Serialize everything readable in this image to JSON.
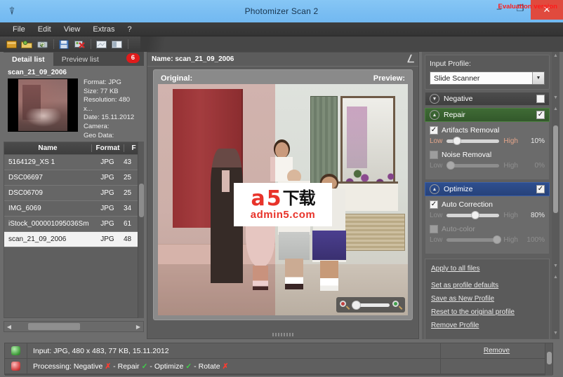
{
  "window": {
    "title": "Photomizer Scan 2",
    "app_icon": "app-logo-icon",
    "minimize": "–",
    "maximize": "❐",
    "close": "✕"
  },
  "menubar": {
    "items": [
      {
        "label": "File"
      },
      {
        "label": "Edit"
      },
      {
        "label": "View"
      },
      {
        "label": "Extras"
      },
      {
        "label": "?"
      }
    ]
  },
  "toolbar": {
    "evaluation_notice": "Evaluation version",
    "buttons": [
      {
        "name": "open-image-icon"
      },
      {
        "name": "open-folder-icon"
      },
      {
        "name": "scan-icon"
      },
      {
        "name": "save-icon"
      },
      {
        "name": "delete-icon"
      },
      {
        "name": "single-view-icon"
      },
      {
        "name": "split-view-icon"
      }
    ]
  },
  "left_panel": {
    "tabs": [
      {
        "label": "Detail list",
        "active": true
      },
      {
        "label": "Preview list",
        "active": false
      }
    ],
    "badge_count": "6",
    "detail": {
      "name": "scan_21_09_2006",
      "format": "Format: JPG",
      "size": "Size: 77 KB",
      "resolution": "Resolution: 480 x...",
      "date": "Date: 15.11.2012",
      "camera": "Camera:",
      "geo": "Geo Data:"
    },
    "table": {
      "columns": [
        "Name",
        "Format",
        "F"
      ],
      "rows": [
        {
          "name": "5164129_XS 1",
          "format": "JPG",
          "size": "43"
        },
        {
          "name": "DSC06697",
          "format": "JPG",
          "size": "25"
        },
        {
          "name": "DSC06709",
          "format": "JPG",
          "size": "25"
        },
        {
          "name": "IMG_6069",
          "format": "JPG",
          "size": "34"
        },
        {
          "name": "iStock_000001095036Sm",
          "format": "JPG",
          "size": "61"
        },
        {
          "name": "scan_21_09_2006",
          "format": "JPG",
          "size": "48",
          "selected": true
        }
      ]
    },
    "hscroll_left": "◀",
    "hscroll_right": "▶"
  },
  "center_panel": {
    "name_label": "Name: scan_21_09_2006",
    "expand_icon": "expand-icon",
    "original_label": "Original:",
    "preview_label": "Preview:",
    "watermark": {
      "letter": "a",
      "digit": "5",
      "cn": "下载",
      "site": "admin5.com"
    },
    "zoom": {
      "zoom_out_icon": "zoom-out-icon",
      "zoom_in_icon": "zoom-in-icon"
    }
  },
  "right_panel": {
    "input_profile_label": "Input Profile:",
    "input_profile_value": "Slide Scanner",
    "dropdown_arrow": "▼",
    "sections": [
      {
        "title": "Negative",
        "state": "collapsed",
        "chevron": "▼",
        "checked": false
      },
      {
        "title": "Repair",
        "state": "expanded",
        "chevron": "▲",
        "checked": true,
        "color": "#3f6b35",
        "options": [
          {
            "label": "Artifacts Removal",
            "checked": true,
            "enabled": true,
            "low": "Low",
            "high": "High",
            "value": "10",
            "unit": "%",
            "pos": 12
          },
          {
            "label": "Noise Removal",
            "checked": false,
            "enabled": false,
            "low": "Low",
            "high": "High",
            "value": "0",
            "unit": "%",
            "pos": 0
          }
        ]
      },
      {
        "title": "Optimize",
        "state": "expanded",
        "chevron": "▲",
        "checked": true,
        "color": "#2e4f8f",
        "options": [
          {
            "label": "Auto Correction",
            "checked": true,
            "enabled": true,
            "low": "Low",
            "high": "High",
            "value": "80",
            "unit": "%",
            "pos": 46
          },
          {
            "label": "Auto-color",
            "checked": false,
            "enabled": false,
            "low": "Low",
            "high": "High",
            "value": "100",
            "unit": "%",
            "pos": 88
          }
        ]
      }
    ],
    "links": [
      {
        "label": "Apply to all files"
      },
      {
        "label": "Set as profile defaults"
      },
      {
        "label": "Save as New Profile"
      },
      {
        "label": "Reset to the original profile"
      },
      {
        "label": "Remove Profile"
      }
    ],
    "scroll_up": "▲",
    "scroll_down": "▼"
  },
  "status_bar": {
    "rows": [
      {
        "icon": "input-file-icon",
        "text": "Input: JPG, 480 x 483, 77 KB, 15.11.2012",
        "action": "Remove"
      },
      {
        "icon": "processing-icon",
        "prefix": "Processing:",
        "steps": [
          {
            "label": "Negative",
            "ok": false
          },
          {
            "label": "Repair",
            "ok": true
          },
          {
            "label": "Optimize",
            "ok": true
          },
          {
            "label": "Rotate",
            "ok": false
          }
        ],
        "separator": "-",
        "ok_mark": "✓",
        "fail_mark": "✗"
      }
    ]
  }
}
